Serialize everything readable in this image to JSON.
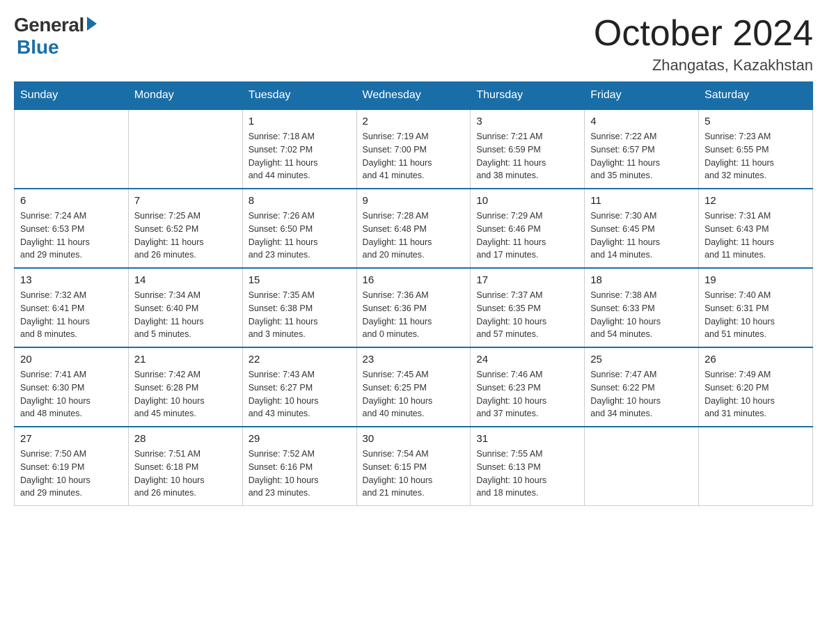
{
  "header": {
    "logo_general": "General",
    "logo_blue": "Blue",
    "month": "October 2024",
    "location": "Zhangatas, Kazakhstan"
  },
  "days_of_week": [
    "Sunday",
    "Monday",
    "Tuesday",
    "Wednesday",
    "Thursday",
    "Friday",
    "Saturday"
  ],
  "weeks": [
    [
      {
        "day": "",
        "info": ""
      },
      {
        "day": "",
        "info": ""
      },
      {
        "day": "1",
        "info": "Sunrise: 7:18 AM\nSunset: 7:02 PM\nDaylight: 11 hours\nand 44 minutes."
      },
      {
        "day": "2",
        "info": "Sunrise: 7:19 AM\nSunset: 7:00 PM\nDaylight: 11 hours\nand 41 minutes."
      },
      {
        "day": "3",
        "info": "Sunrise: 7:21 AM\nSunset: 6:59 PM\nDaylight: 11 hours\nand 38 minutes."
      },
      {
        "day": "4",
        "info": "Sunrise: 7:22 AM\nSunset: 6:57 PM\nDaylight: 11 hours\nand 35 minutes."
      },
      {
        "day": "5",
        "info": "Sunrise: 7:23 AM\nSunset: 6:55 PM\nDaylight: 11 hours\nand 32 minutes."
      }
    ],
    [
      {
        "day": "6",
        "info": "Sunrise: 7:24 AM\nSunset: 6:53 PM\nDaylight: 11 hours\nand 29 minutes."
      },
      {
        "day": "7",
        "info": "Sunrise: 7:25 AM\nSunset: 6:52 PM\nDaylight: 11 hours\nand 26 minutes."
      },
      {
        "day": "8",
        "info": "Sunrise: 7:26 AM\nSunset: 6:50 PM\nDaylight: 11 hours\nand 23 minutes."
      },
      {
        "day": "9",
        "info": "Sunrise: 7:28 AM\nSunset: 6:48 PM\nDaylight: 11 hours\nand 20 minutes."
      },
      {
        "day": "10",
        "info": "Sunrise: 7:29 AM\nSunset: 6:46 PM\nDaylight: 11 hours\nand 17 minutes."
      },
      {
        "day": "11",
        "info": "Sunrise: 7:30 AM\nSunset: 6:45 PM\nDaylight: 11 hours\nand 14 minutes."
      },
      {
        "day": "12",
        "info": "Sunrise: 7:31 AM\nSunset: 6:43 PM\nDaylight: 11 hours\nand 11 minutes."
      }
    ],
    [
      {
        "day": "13",
        "info": "Sunrise: 7:32 AM\nSunset: 6:41 PM\nDaylight: 11 hours\nand 8 minutes."
      },
      {
        "day": "14",
        "info": "Sunrise: 7:34 AM\nSunset: 6:40 PM\nDaylight: 11 hours\nand 5 minutes."
      },
      {
        "day": "15",
        "info": "Sunrise: 7:35 AM\nSunset: 6:38 PM\nDaylight: 11 hours\nand 3 minutes."
      },
      {
        "day": "16",
        "info": "Sunrise: 7:36 AM\nSunset: 6:36 PM\nDaylight: 11 hours\nand 0 minutes."
      },
      {
        "day": "17",
        "info": "Sunrise: 7:37 AM\nSunset: 6:35 PM\nDaylight: 10 hours\nand 57 minutes."
      },
      {
        "day": "18",
        "info": "Sunrise: 7:38 AM\nSunset: 6:33 PM\nDaylight: 10 hours\nand 54 minutes."
      },
      {
        "day": "19",
        "info": "Sunrise: 7:40 AM\nSunset: 6:31 PM\nDaylight: 10 hours\nand 51 minutes."
      }
    ],
    [
      {
        "day": "20",
        "info": "Sunrise: 7:41 AM\nSunset: 6:30 PM\nDaylight: 10 hours\nand 48 minutes."
      },
      {
        "day": "21",
        "info": "Sunrise: 7:42 AM\nSunset: 6:28 PM\nDaylight: 10 hours\nand 45 minutes."
      },
      {
        "day": "22",
        "info": "Sunrise: 7:43 AM\nSunset: 6:27 PM\nDaylight: 10 hours\nand 43 minutes."
      },
      {
        "day": "23",
        "info": "Sunrise: 7:45 AM\nSunset: 6:25 PM\nDaylight: 10 hours\nand 40 minutes."
      },
      {
        "day": "24",
        "info": "Sunrise: 7:46 AM\nSunset: 6:23 PM\nDaylight: 10 hours\nand 37 minutes."
      },
      {
        "day": "25",
        "info": "Sunrise: 7:47 AM\nSunset: 6:22 PM\nDaylight: 10 hours\nand 34 minutes."
      },
      {
        "day": "26",
        "info": "Sunrise: 7:49 AM\nSunset: 6:20 PM\nDaylight: 10 hours\nand 31 minutes."
      }
    ],
    [
      {
        "day": "27",
        "info": "Sunrise: 7:50 AM\nSunset: 6:19 PM\nDaylight: 10 hours\nand 29 minutes."
      },
      {
        "day": "28",
        "info": "Sunrise: 7:51 AM\nSunset: 6:18 PM\nDaylight: 10 hours\nand 26 minutes."
      },
      {
        "day": "29",
        "info": "Sunrise: 7:52 AM\nSunset: 6:16 PM\nDaylight: 10 hours\nand 23 minutes."
      },
      {
        "day": "30",
        "info": "Sunrise: 7:54 AM\nSunset: 6:15 PM\nDaylight: 10 hours\nand 21 minutes."
      },
      {
        "day": "31",
        "info": "Sunrise: 7:55 AM\nSunset: 6:13 PM\nDaylight: 10 hours\nand 18 minutes."
      },
      {
        "day": "",
        "info": ""
      },
      {
        "day": "",
        "info": ""
      }
    ]
  ]
}
